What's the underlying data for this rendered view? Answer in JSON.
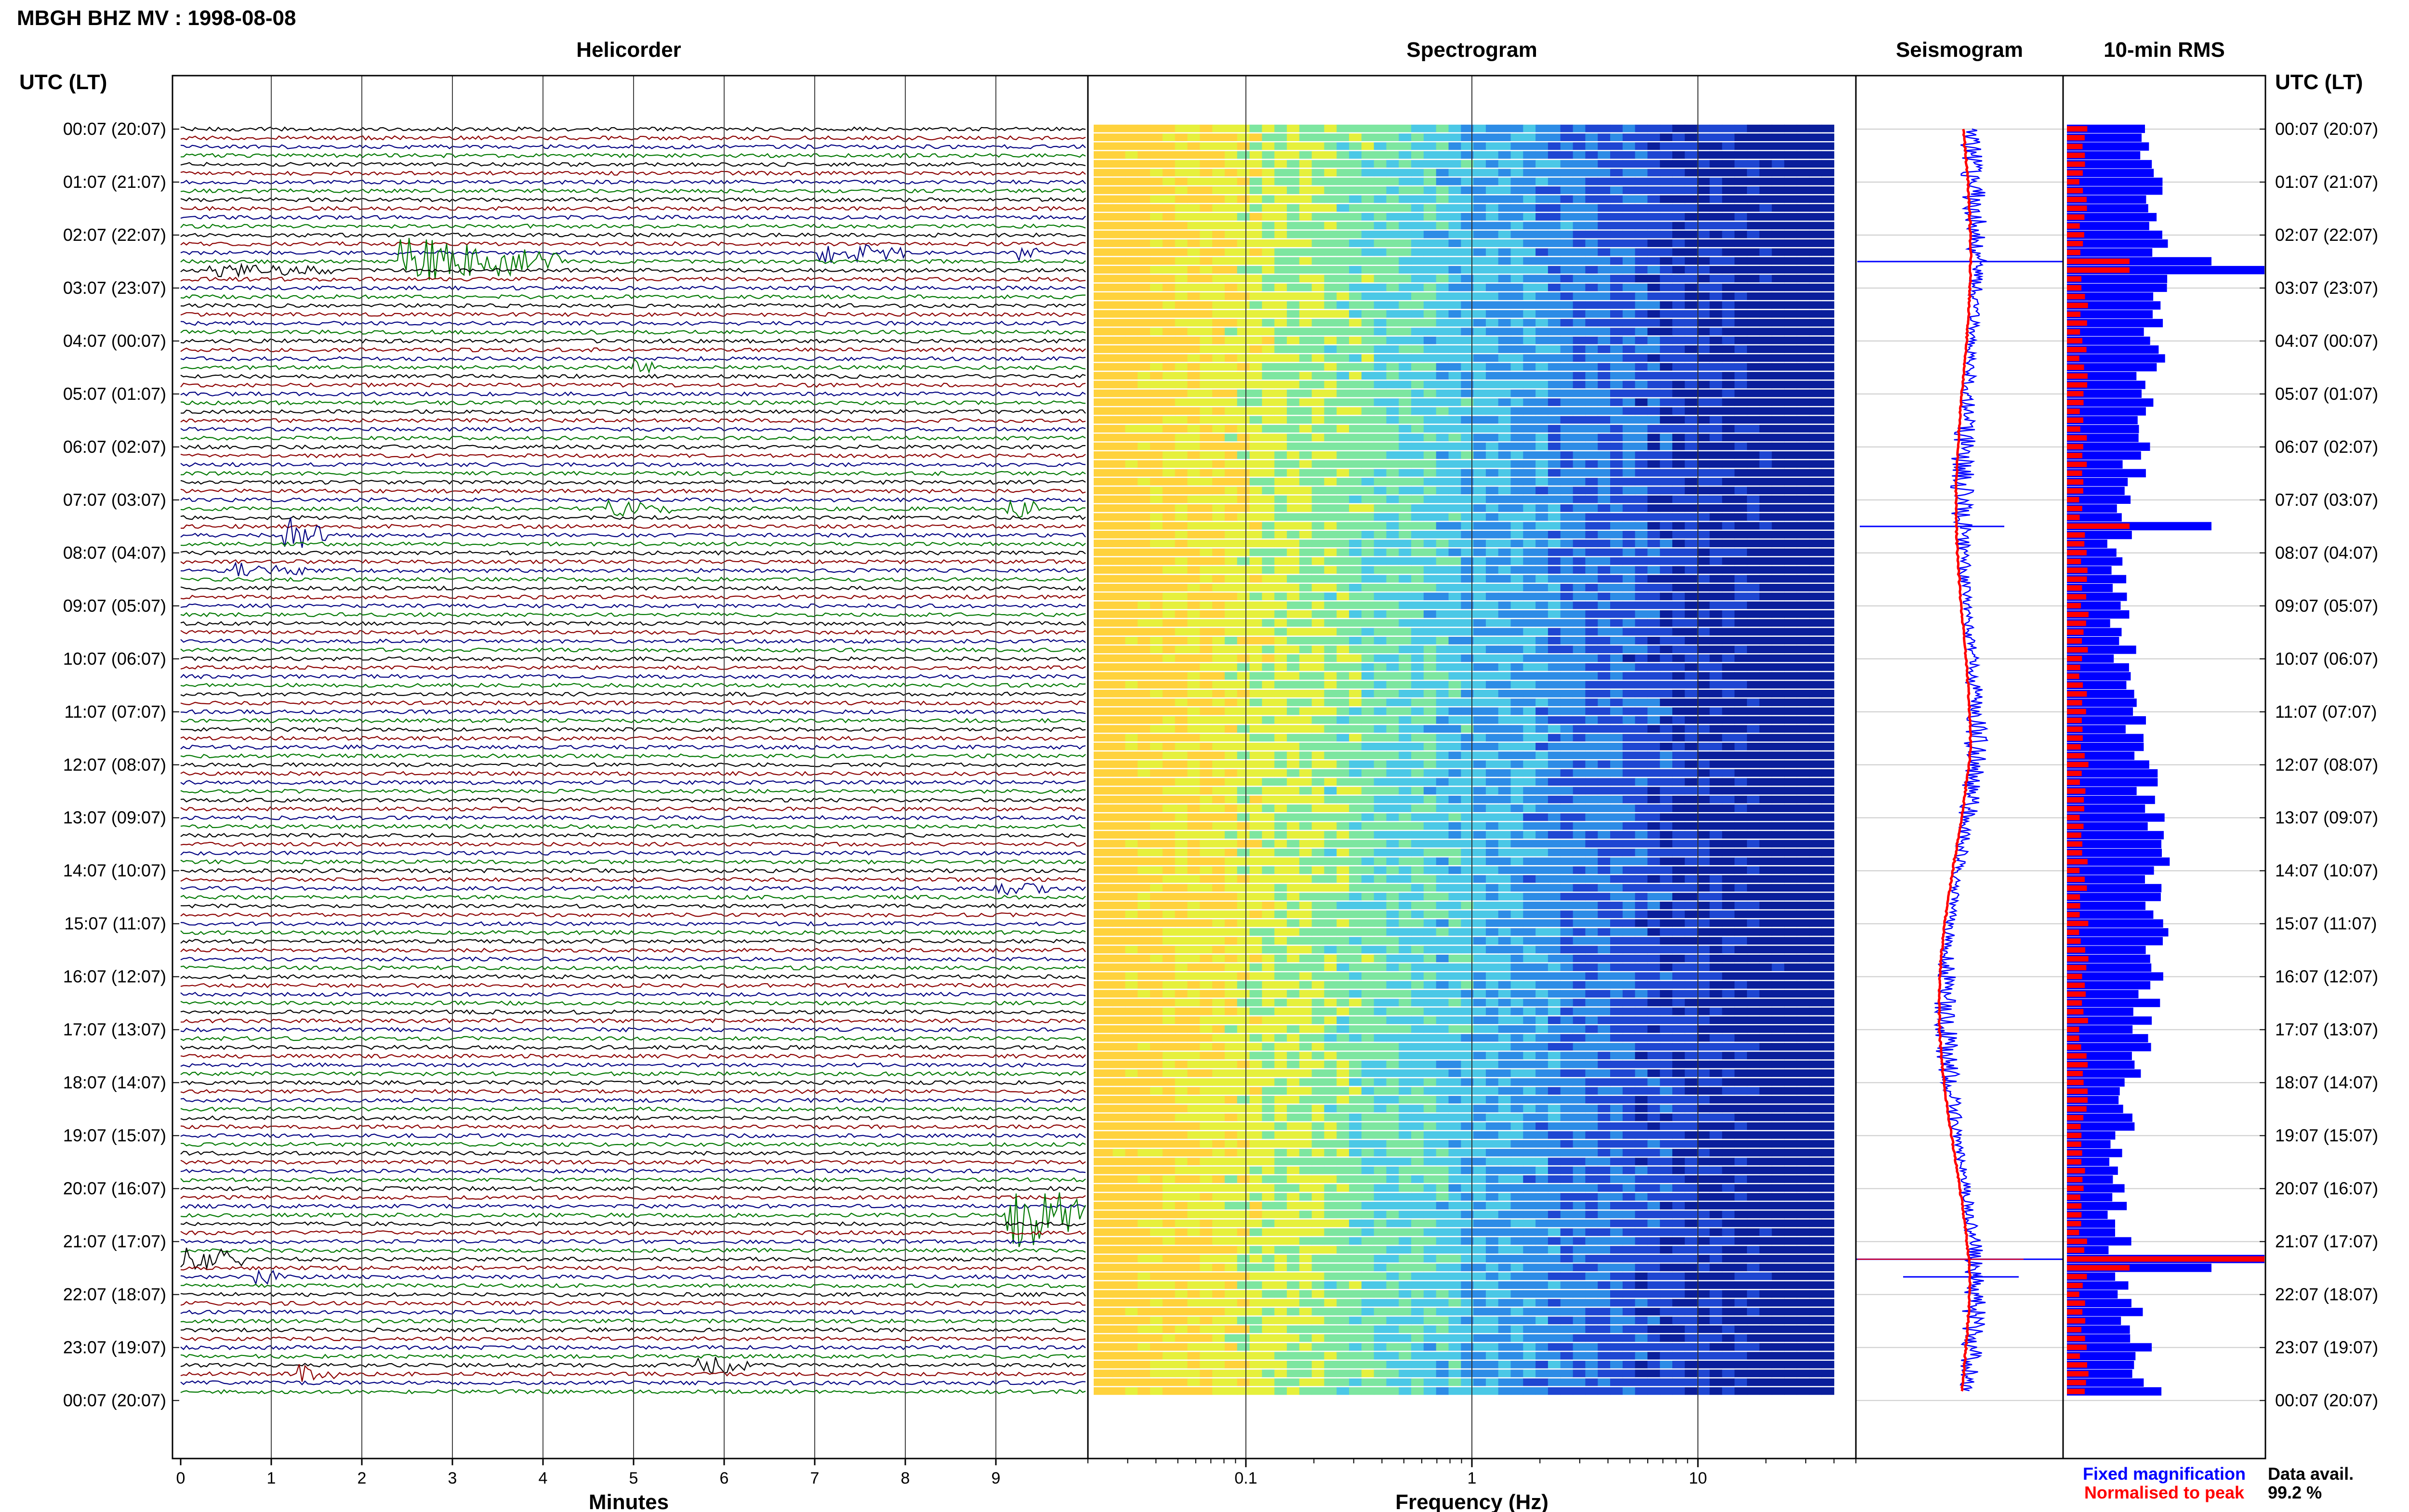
{
  "figure": {
    "title": "MBGH BHZ MV : 1998-08-08",
    "time_axis_label": "UTC (LT)",
    "data_avail_label": "Data avail.",
    "data_avail_value": "99.2 %",
    "colors": {
      "trace_cycle": [
        "#000000",
        "#8b0000",
        "#000080",
        "#007700"
      ],
      "fixed": "#0000ff",
      "normalised": "#ff0000"
    }
  },
  "chart_data": [
    {
      "type": "line",
      "panel": "helicorder",
      "title": "Helicorder",
      "xlabel": "Minutes",
      "xlim": [
        0,
        10
      ],
      "xticks": [
        "0",
        "1",
        "2",
        "3",
        "4",
        "5",
        "6",
        "7",
        "8",
        "9"
      ],
      "row_minutes": 10,
      "rows": 144,
      "start_utc": "00:07",
      "hour_labels": [
        "00:07 (20:07)",
        "01:07 (21:07)",
        "02:07 (22:07)",
        "03:07 (23:07)",
        "04:07 (00:07)",
        "05:07 (01:07)",
        "06:07 (02:07)",
        "07:07 (03:07)",
        "08:07 (04:07)",
        "09:07 (05:07)",
        "10:07 (06:07)",
        "11:07 (07:07)",
        "12:07 (08:07)",
        "13:07 (09:07)",
        "14:07 (10:07)",
        "15:07 (11:07)",
        "16:07 (12:07)",
        "17:07 (13:07)",
        "18:07 (14:07)",
        "19:07 (15:07)",
        "20:07 (16:07)",
        "21:07 (17:07)",
        "22:07 (18:07)",
        "23:07 (19:07)",
        "00:07 (20:07)"
      ],
      "events": [
        {
          "row": 15,
          "minute": 2.4,
          "duration": 1.8,
          "amp": 3.5
        },
        {
          "row": 14,
          "minute": 7.0,
          "duration": 1.0,
          "amp": 1.6
        },
        {
          "row": 14,
          "minute": 9.2,
          "duration": 0.3,
          "amp": 1.0
        },
        {
          "row": 16,
          "minute": 0.3,
          "duration": 1.4,
          "amp": 0.8
        },
        {
          "row": 27,
          "minute": 5.0,
          "duration": 0.3,
          "amp": 1.0
        },
        {
          "row": 43,
          "minute": 4.7,
          "duration": 0.8,
          "amp": 1.0
        },
        {
          "row": 43,
          "minute": 9.1,
          "duration": 0.4,
          "amp": 1.8
        },
        {
          "row": 46,
          "minute": 1.1,
          "duration": 0.5,
          "amp": 3.0
        },
        {
          "row": 50,
          "minute": 0.6,
          "duration": 0.8,
          "amp": 0.9
        },
        {
          "row": 86,
          "minute": 9.0,
          "duration": 0.6,
          "amp": 0.9
        },
        {
          "row": 128,
          "minute": 0.0,
          "duration": 0.8,
          "amp": 2.0
        },
        {
          "row": 123,
          "minute": 9.1,
          "duration": 0.9,
          "amp": 6.0
        },
        {
          "row": 130,
          "minute": 0.8,
          "duration": 0.3,
          "amp": 1.4
        },
        {
          "row": 140,
          "minute": 5.7,
          "duration": 0.6,
          "amp": 1.4
        },
        {
          "row": 141,
          "minute": 1.3,
          "duration": 0.4,
          "amp": 1.2
        }
      ]
    },
    {
      "type": "heatmap",
      "panel": "spectrogram",
      "title": "Spectrogram",
      "xlabel": "Frequency (Hz)",
      "xscale": "log",
      "xlim": [
        0.02,
        50
      ],
      "xticks": [
        "0.1",
        "1",
        "10"
      ],
      "data_max_hz": 40,
      "rows": 144,
      "colormap": [
        "#ffd23c",
        "#e6f03c",
        "#7de6a0",
        "#4bc8e6",
        "#2d8ce6",
        "#1e46d2",
        "#0a1e9b"
      ]
    },
    {
      "type": "line",
      "panel": "seismogram",
      "title": "Seismogram",
      "legend": [
        {
          "name": "Fixed magnification",
          "color": "#0000ff"
        },
        {
          "name": "Normalised to peak",
          "color": "#ff0000"
        }
      ],
      "grid": true
    },
    {
      "type": "bar",
      "panel": "rms",
      "title": "10-min RMS",
      "orientation": "horizontal",
      "rows": 144,
      "peak_rows": [
        15,
        16,
        45,
        128,
        129
      ]
    }
  ]
}
